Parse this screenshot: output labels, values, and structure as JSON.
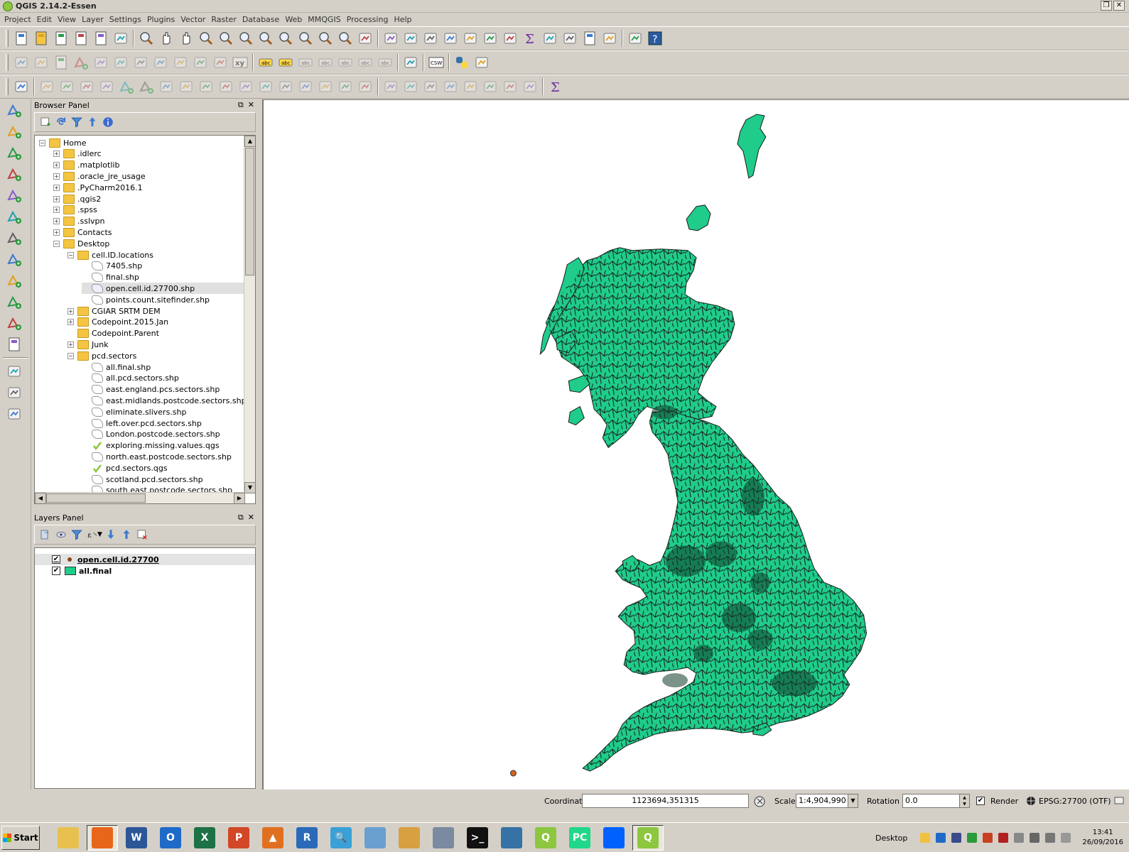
{
  "app": {
    "title": "QGIS 2.14.2-Essen"
  },
  "menubar": [
    "Project",
    "Edit",
    "View",
    "Layer",
    "Settings",
    "Plugins",
    "Vector",
    "Raster",
    "Database",
    "Web",
    "MMQGIS",
    "Processing",
    "Help"
  ],
  "browser_panel": {
    "title": "Browser Panel",
    "tree": [
      {
        "label": "Home",
        "depth": 0,
        "type": "folder",
        "expanded": true
      },
      {
        "label": ".idlerc",
        "depth": 1,
        "type": "folder"
      },
      {
        "label": ".matplotlib",
        "depth": 1,
        "type": "folder"
      },
      {
        "label": ".oracle_jre_usage",
        "depth": 1,
        "type": "folder"
      },
      {
        "label": ".PyCharm2016.1",
        "depth": 1,
        "type": "folder"
      },
      {
        "label": ".qgis2",
        "depth": 1,
        "type": "folder"
      },
      {
        "label": ".spss",
        "depth": 1,
        "type": "folder"
      },
      {
        "label": ".sslvpn",
        "depth": 1,
        "type": "folder"
      },
      {
        "label": "Contacts",
        "depth": 1,
        "type": "folder"
      },
      {
        "label": "Desktop",
        "depth": 1,
        "type": "folder",
        "expanded": true
      },
      {
        "label": "cell.ID.locations",
        "depth": 2,
        "type": "folder",
        "expanded": true
      },
      {
        "label": "7405.shp",
        "depth": 3,
        "type": "shp"
      },
      {
        "label": "final.shp",
        "depth": 3,
        "type": "shp"
      },
      {
        "label": "open.cell.id.27700.shp",
        "depth": 3,
        "type": "shp",
        "selected": true
      },
      {
        "label": "points.count.sitefinder.shp",
        "depth": 3,
        "type": "shp"
      },
      {
        "label": "CGIAR SRTM DEM",
        "depth": 2,
        "type": "folder"
      },
      {
        "label": "Codepoint.2015.Jan",
        "depth": 2,
        "type": "folder"
      },
      {
        "label": "Codepoint.Parent",
        "depth": 2,
        "type": "folder",
        "noexp": true
      },
      {
        "label": "Junk",
        "depth": 2,
        "type": "folder"
      },
      {
        "label": "pcd.sectors",
        "depth": 2,
        "type": "folder",
        "expanded": true
      },
      {
        "label": "all.final.shp",
        "depth": 3,
        "type": "shp"
      },
      {
        "label": "all.pcd.sectors.shp",
        "depth": 3,
        "type": "shp"
      },
      {
        "label": "east.england.pcs.sectors.shp",
        "depth": 3,
        "type": "shp"
      },
      {
        "label": "east.midlands.postcode.sectors.shp",
        "depth": 3,
        "type": "shp"
      },
      {
        "label": "eliminate.slivers.shp",
        "depth": 3,
        "type": "shp"
      },
      {
        "label": "left.over.pcd.sectors.shp",
        "depth": 3,
        "type": "shp"
      },
      {
        "label": "London.postcode.sectors.shp",
        "depth": 3,
        "type": "shp"
      },
      {
        "label": "exploring.missing.values.qgs",
        "depth": 3,
        "type": "qgs"
      },
      {
        "label": "north.east.postcode.sectors.shp",
        "depth": 3,
        "type": "shp"
      },
      {
        "label": "pcd.sectors.qgs",
        "depth": 3,
        "type": "qgs"
      },
      {
        "label": "scotland.pcd.sectors.shp",
        "depth": 3,
        "type": "shp"
      },
      {
        "label": "south.east.postcode.sectors.shp",
        "depth": 3,
        "type": "shp"
      }
    ]
  },
  "layers_panel": {
    "title": "Layers Panel",
    "layers": [
      {
        "name": "open.cell.id.27700",
        "checked": true,
        "symbol": "point",
        "selected": true
      },
      {
        "name": "all.final",
        "checked": true,
        "symbol": "polygon"
      }
    ]
  },
  "statusbar": {
    "coordinate_label": "Coordinate",
    "coordinate_value": "1123694,351315",
    "scale_label": "Scale",
    "scale_value": "1:4,904,990",
    "rotation_label": "Rotation",
    "rotation_value": "0.0",
    "render_label": "Render",
    "crs": "EPSG:27700 (OTF)"
  },
  "map": {
    "fill_color": "#1fcc8a",
    "stroke_color": "#1a1a1a"
  },
  "taskbar": {
    "start_label": "Start",
    "desktop_label": "Desktop",
    "clock_time": "13:41",
    "clock_date": "26/09/2016"
  },
  "icons": {
    "toolbar1": [
      "new-project-icon",
      "open-project-icon",
      "save-project-icon",
      "save-as-icon",
      "new-print-composer-icon",
      "composer-manager-icon",
      "touch-zoom-icon",
      "pan-icon",
      "pan-to-selection-icon",
      "zoom-in-icon",
      "zoom-out-icon",
      "zoom-native-icon",
      "zoom-full-icon",
      "zoom-to-selection-icon",
      "zoom-to-layer-icon",
      "zoom-last-icon",
      "zoom-next-icon",
      "refresh-icon",
      "identify-icon",
      "action-icon",
      "select-icon",
      "select-by-value-icon",
      "deselect-icon",
      "attribute-table-icon",
      "field-calculator-icon",
      "statistics-icon",
      "measure-icon",
      "map-tips-icon",
      "new-bookmark-icon",
      "show-bookmarks-icon",
      "text-annotation-icon",
      "help-icon"
    ],
    "toolbar2": [
      "current-edits-icon",
      "toggle-editing-icon",
      "save-edits-icon",
      "add-feature-icon",
      "move-feature-icon",
      "node-tool-icon",
      "delete-selected-icon",
      "cut-features-icon",
      "copy-features-icon",
      "paste-features-icon",
      "digitize-icon",
      "xy-icon",
      "label-icon",
      "label-pin-icon",
      "label-show-icon",
      "label-move-icon",
      "label-rotate-icon",
      "label-change-icon",
      "label-hide-icon",
      "db-manager-icon",
      "csw-icon",
      "python-icon",
      "plugin-icon"
    ],
    "toolbar3": [
      "snapping-icon",
      "rotate-point-icon",
      "undo-icon",
      "redo-icon",
      "simplify-icon",
      "add-ring-icon",
      "add-part-icon",
      "fill-ring-icon",
      "delete-ring-icon",
      "delete-part-icon",
      "reshape-icon",
      "offset-curve-icon",
      "split-features-icon",
      "split-parts-icon",
      "merge-features-icon",
      "merge-attributes-icon",
      "rotate-symbols-icon",
      "curve-icon",
      "align-icon",
      "align-2-icon",
      "align-3-icon",
      "align-4-icon",
      "raise-icon",
      "lower-icon",
      "locate-icon",
      "locate-2-icon",
      "sum-icon"
    ],
    "left": [
      "add-vector-icon",
      "add-raster-icon",
      "add-postgis-icon",
      "add-spatialite-icon",
      "add-mssql-icon",
      "add-oracle-icon",
      "add-wms-icon",
      "add-wcs-icon",
      "add-wfs-icon",
      "add-delimited-icon",
      "add-virtual-icon",
      "new-shapefile-icon",
      "georeferencer-icon",
      "gps-icon",
      "notes-icon"
    ]
  }
}
